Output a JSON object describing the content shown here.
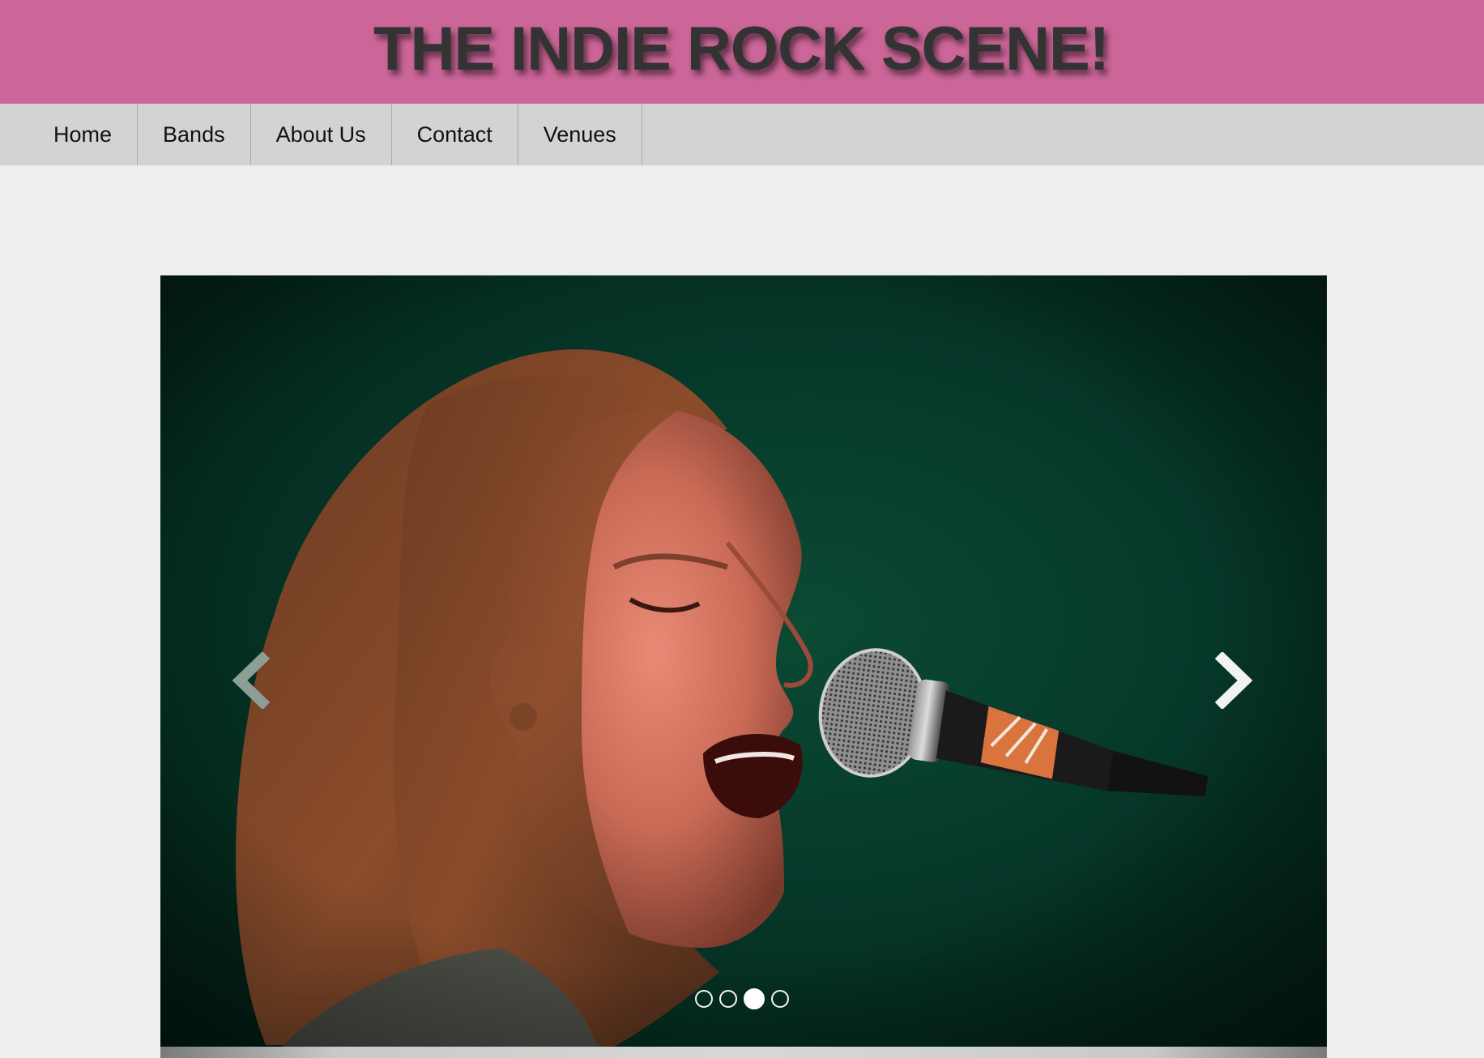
{
  "header": {
    "title": "THE INDIE ROCK SCENE!",
    "background_color": "#cc6699"
  },
  "nav": {
    "items": [
      {
        "label": "Home"
      },
      {
        "label": "Bands"
      },
      {
        "label": "About Us"
      },
      {
        "label": "Contact"
      },
      {
        "label": "Venues"
      }
    ]
  },
  "carousel": {
    "image_description": "singer-performing-at-microphone",
    "prev_icon": "chevron-left-icon",
    "next_icon": "chevron-right-icon",
    "slide_count": 4,
    "active_slide_index": 2
  },
  "colors": {
    "page_background": "#eeeeee",
    "nav_background": "#d3d3d3",
    "title_text": "#333333"
  }
}
